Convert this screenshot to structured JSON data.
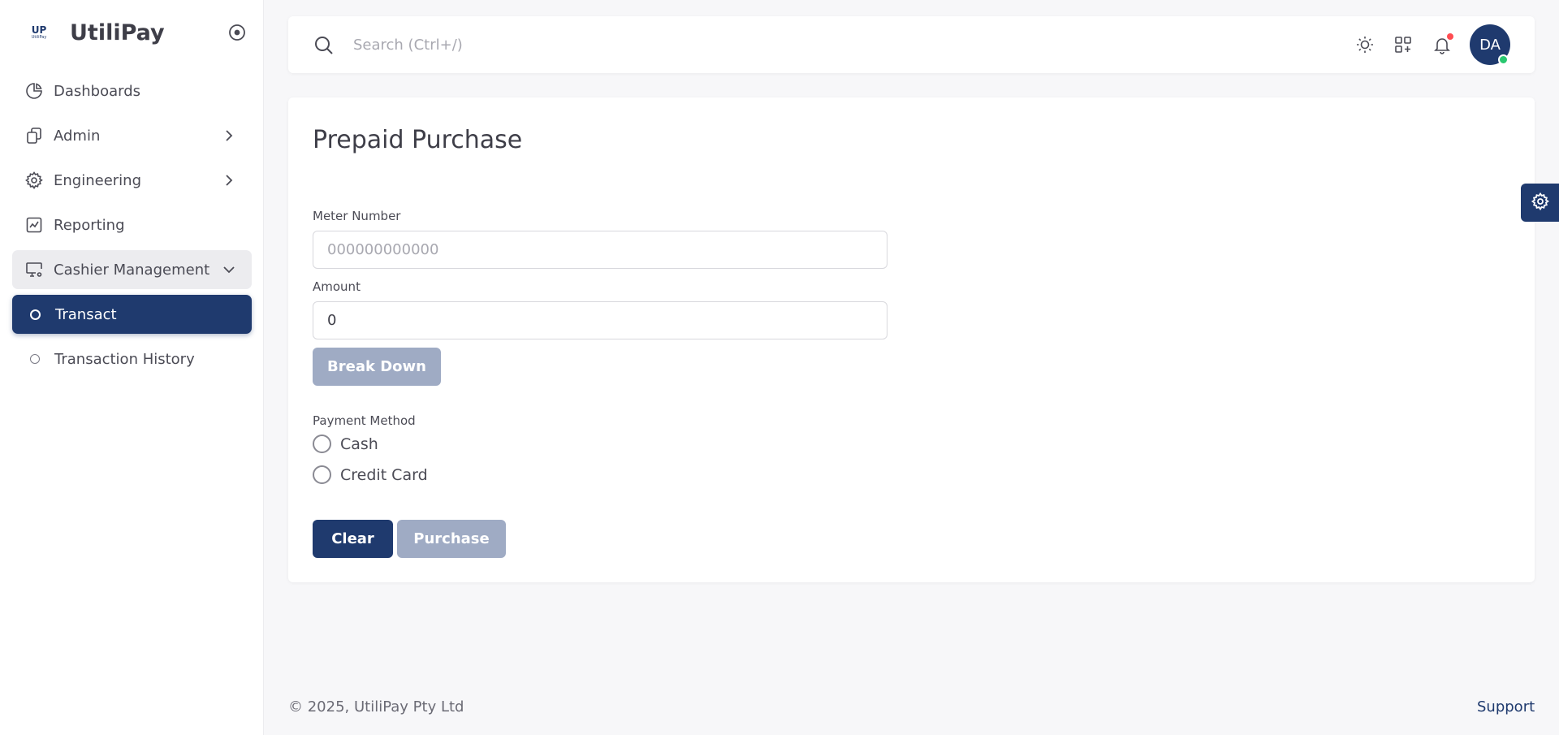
{
  "brand": {
    "logo_letters": "UP",
    "logo_subtext": "UtiliPay",
    "name": "UtiliPay"
  },
  "sidebar": {
    "items": [
      {
        "label": "Dashboards",
        "icon": "pie-chart-icon"
      },
      {
        "label": "Admin",
        "icon": "copy-icon",
        "has_chevron": true
      },
      {
        "label": "Engineering",
        "icon": "gear-icon",
        "has_chevron": true
      },
      {
        "label": "Reporting",
        "icon": "chart-line-icon"
      },
      {
        "label": "Cashier Management",
        "icon": "monitor-gear-icon",
        "expanded": true
      },
      {
        "label": "Transact",
        "active": true
      },
      {
        "label": "Transaction History"
      }
    ]
  },
  "search": {
    "placeholder": "Search (Ctrl+/)"
  },
  "user": {
    "initials": "DA",
    "status_color": "#28c76f"
  },
  "page": {
    "title": "Prepaid Purchase",
    "meter_label": "Meter Number",
    "meter_placeholder": "000000000000",
    "amount_label": "Amount",
    "amount_value": "0",
    "breakdown_label": "Break Down",
    "payment_label": "Payment Method",
    "payment_options": [
      "Cash",
      "Credit Card"
    ],
    "clear_label": "Clear",
    "purchase_label": "Purchase"
  },
  "footer": {
    "copyright": "© 2025, UtiliPay Pty Ltd",
    "support": "Support"
  },
  "colors": {
    "primary": "#1f3a6e",
    "disabled": "#9fabc4",
    "notification": "#ff4c51"
  }
}
